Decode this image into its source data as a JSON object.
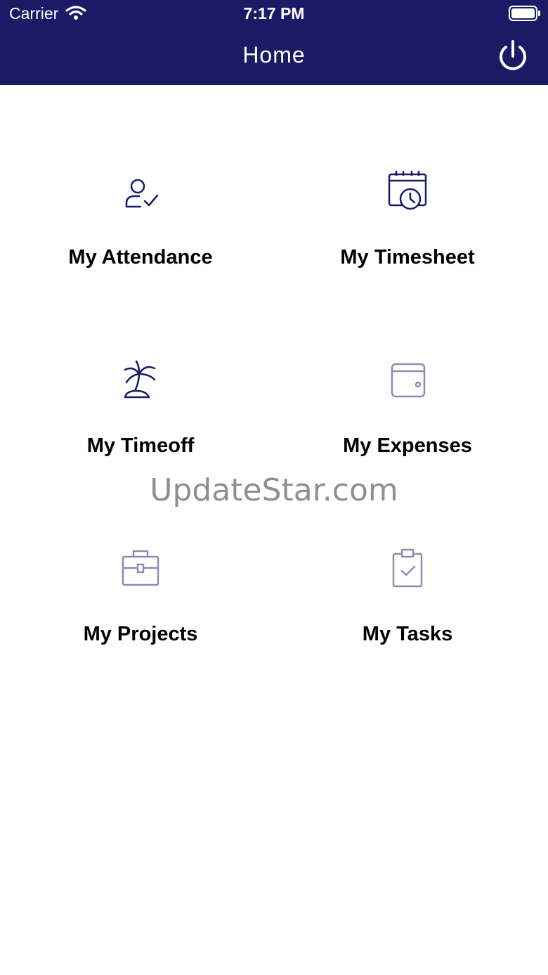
{
  "status_bar": {
    "carrier": "Carrier",
    "time": "7:17 PM"
  },
  "header": {
    "title": "Home",
    "power_icon": "power-icon"
  },
  "colors": {
    "header_bg": "#1b1a67",
    "icon_active": "#1b1a67",
    "icon_muted": "#8f8bb3",
    "text": "#000000",
    "watermark": "#8f8f8f"
  },
  "menu": [
    {
      "label": "My Attendance",
      "icon": "user-check-icon"
    },
    {
      "label": "My Timesheet",
      "icon": "calendar-clock-icon"
    },
    {
      "label": "My Timeoff",
      "icon": "palm-tree-icon"
    },
    {
      "label": "My Expenses",
      "icon": "wallet-icon"
    },
    {
      "label": "My Projects",
      "icon": "briefcase-icon"
    },
    {
      "label": "My Tasks",
      "icon": "clipboard-check-icon"
    }
  ],
  "watermark": "UpdateStar.com"
}
